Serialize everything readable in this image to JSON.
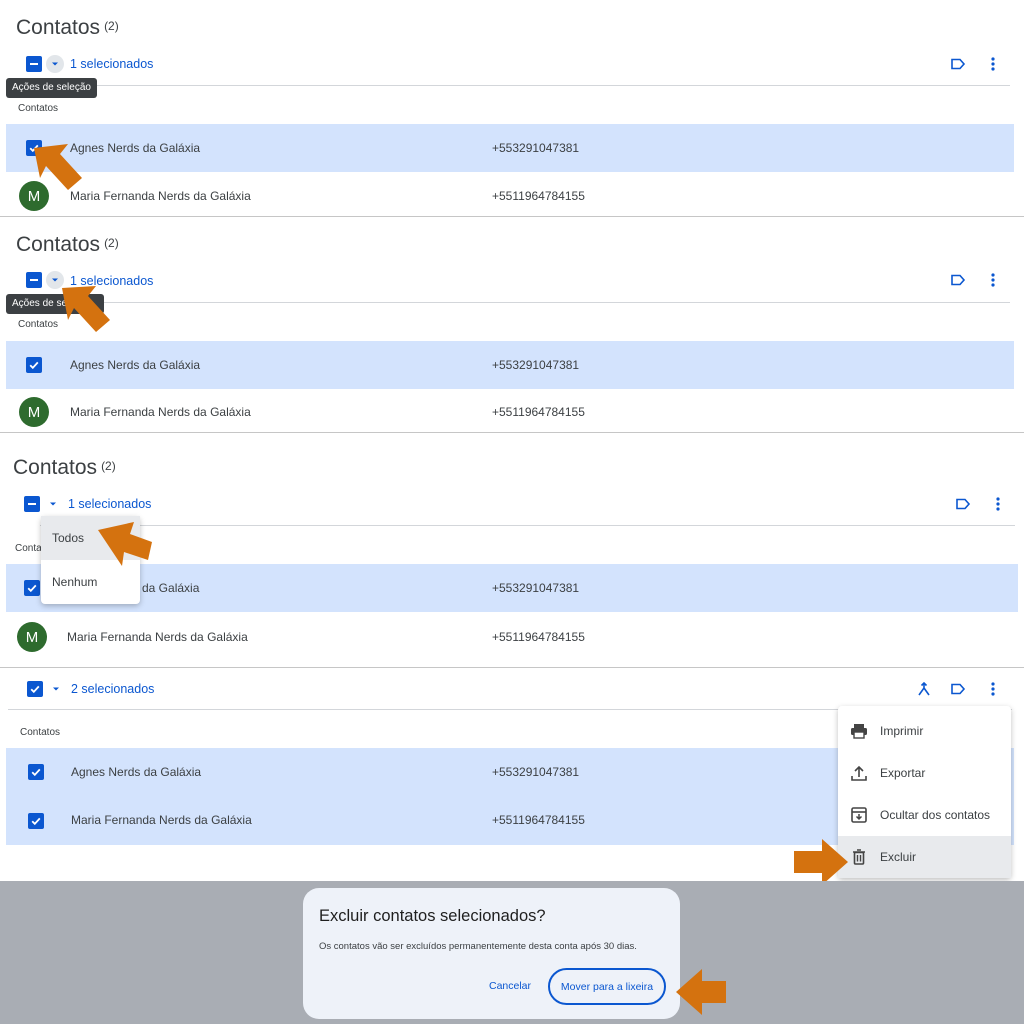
{
  "panels": [
    {
      "title": "Contatos",
      "count": "(2)",
      "selection_label": "1 selecionados",
      "tooltip": "Ações de seleção",
      "column_header": "Contatos",
      "rows": [
        {
          "name": "Agnes Nerds da Galáxia",
          "phone": "+553291047381",
          "selected": true
        },
        {
          "name": "Maria Fernanda Nerds da Galáxia",
          "phone": "+5511964784155",
          "avatar": "M",
          "selected": false
        }
      ]
    },
    {
      "title": "Contatos",
      "count": "(2)",
      "selection_label": "1 selecionados",
      "tooltip": "Ações de se",
      "column_header": "Contatos",
      "rows": [
        {
          "name": "Agnes Nerds da Galáxia",
          "phone": "+553291047381",
          "selected": true
        },
        {
          "name": "Maria Fernanda Nerds da Galáxia",
          "phone": "+5511964784155",
          "avatar": "M",
          "selected": false
        }
      ]
    },
    {
      "title": "Contatos",
      "count": "(2)",
      "selection_label": "1 selecionados",
      "column_header": "Conta",
      "dropdown_options": [
        "Todos",
        "Nenhum"
      ],
      "rows": [
        {
          "name": "da Galáxia",
          "phone": "+553291047381",
          "selected": true
        },
        {
          "name": "Maria Fernanda Nerds da Galáxia",
          "phone": "+5511964784155",
          "avatar": "M",
          "selected": false
        }
      ]
    },
    {
      "selection_label": "2 selecionados",
      "column_header": "Contatos",
      "rows": [
        {
          "name": "Agnes Nerds da Galáxia",
          "phone": "+553291047381",
          "selected": true
        },
        {
          "name": "Maria Fernanda Nerds da Galáxia",
          "phone": "+5511964784155",
          "selected": true
        }
      ],
      "more_menu": [
        {
          "label": "Imprimir",
          "icon": "print-icon"
        },
        {
          "label": "Exportar",
          "icon": "export-icon"
        },
        {
          "label": "Ocultar dos contatos",
          "icon": "hide-contacts-icon"
        },
        {
          "label": "Excluir",
          "icon": "trash-icon"
        }
      ]
    }
  ],
  "dialog": {
    "title": "Excluir contatos selecionados?",
    "message": "Os contatos vão ser excluídos permanentemente desta conta após 30 dias.",
    "cancel_label": "Cancelar",
    "confirm_label": "Mover para a lixeira"
  },
  "colors": {
    "accent": "#0b57d0",
    "selected_row": "#d3e3fd",
    "highlight_arrow": "#d4720f",
    "avatar": "#2e6b2e",
    "overlay": "#a9adb4"
  }
}
